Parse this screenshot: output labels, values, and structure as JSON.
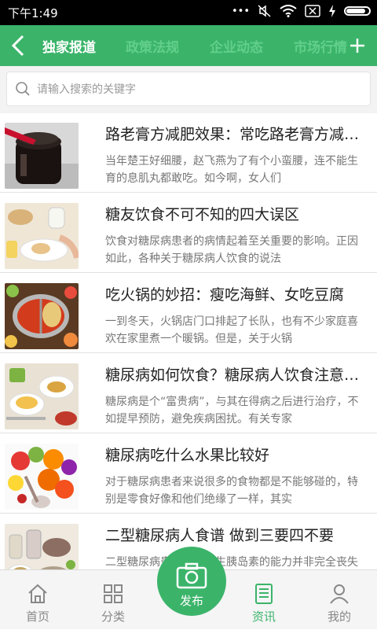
{
  "status": {
    "time": "下午1:49"
  },
  "nav": {
    "tabs": [
      {
        "label": "独家报道",
        "active": true
      },
      {
        "label": "政策法规",
        "active": false
      },
      {
        "label": "企业动态",
        "active": false
      },
      {
        "label": "市场行情",
        "active": false
      }
    ]
  },
  "search": {
    "placeholder": "请输入搜索的关键字"
  },
  "articles": [
    {
      "title": "路老膏方减肥效果：常吃路老膏方减肥效果",
      "desc": "当年楚王好细腰，赵飞燕为了有个小蛮腰，连不能生育的息肌丸都敢吃。如今啊，女人们"
    },
    {
      "title": "糖友饮食不可不知的四大误区",
      "desc": "饮食对糖尿病患者的病情起着至关重要的影响。正因如此，各种关于糖尿病人饮食的说法"
    },
    {
      "title": "吃火锅的妙招：瘦吃海鲜、女吃豆腐",
      "desc": "一到冬天，火锅店门口排起了长队，也有不少家庭喜欢在家里煮一个暖锅。但是，关于火锅"
    },
    {
      "title": "糖尿病如何饮食？糖尿病人饮食注意事项",
      "desc": "糖尿病是个“富贵病”，与其在得病之后进行治疗，不如提早预防，避免疾病困扰。有关专家"
    },
    {
      "title": "糖尿病吃什么水果比较好",
      "desc": "对于糖尿病患者来说很多的食物都是不能够碰的，特别是零食好像和他们绝缘了一样，其实"
    },
    {
      "title": "二型糖尿病人食谱 做到三要四不要",
      "desc": "二型糖尿病患者体内产生胰岛素的能力并非完全丧失"
    }
  ],
  "tabbar": {
    "home": "首页",
    "category": "分类",
    "publish": "发布",
    "news": "资讯",
    "mine": "我的",
    "active": "news"
  },
  "colors": {
    "brand": "#3bb46a",
    "inactive_tab": "#62cf8a"
  }
}
